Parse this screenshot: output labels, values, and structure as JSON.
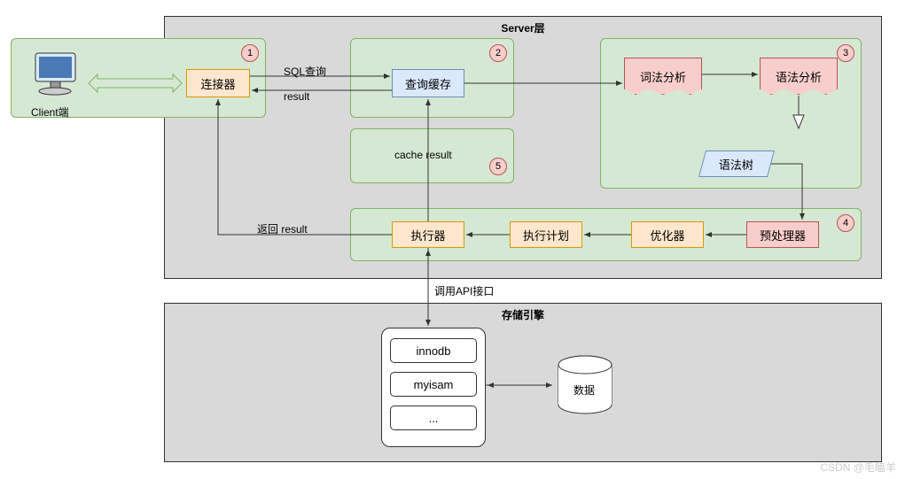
{
  "client_label": "Client端",
  "server_layer": "Server层",
  "storage_layer": "存储引擎",
  "connector": "连接器",
  "query_cache": "查询缓存",
  "lexical": "词法分析",
  "syntax": "语法分析",
  "syntax_tree": "语法树",
  "preprocessor": "预处理器",
  "optimizer": "优化器",
  "exec_plan": "执行计划",
  "executor": "执行器",
  "cache_result": "cache result",
  "sql_query": "SQL查询",
  "result": "result",
  "return_result": "返回 result",
  "api_call": "调用API接口",
  "innodb": "innodb",
  "myisam": "myisam",
  "ellipsis": "...",
  "data": "数据",
  "badge1": "1",
  "badge2": "2",
  "badge3": "3",
  "badge4": "4",
  "badge5": "5",
  "watermark": "CSDN @毛瞌羊"
}
